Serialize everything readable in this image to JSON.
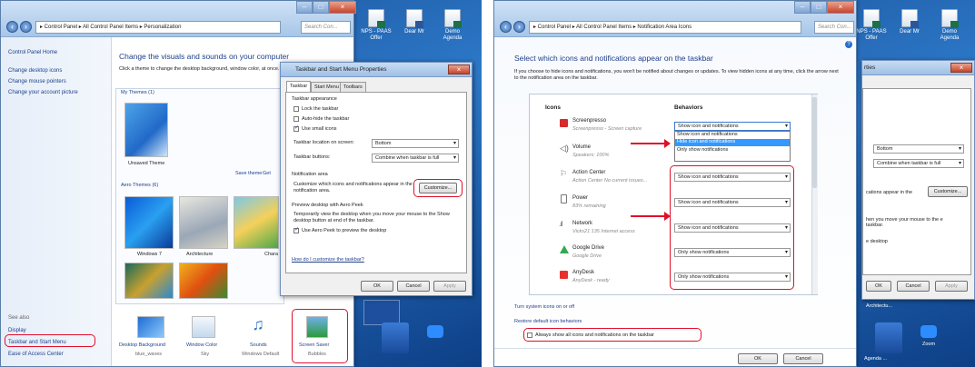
{
  "left": {
    "address": "▸ Control Panel ▸ All Control Panel Items ▸ Personalization",
    "search_placeholder": "Search Con...",
    "desktop_icons": [
      {
        "label": "NPS - PAAS Offer"
      },
      {
        "label": "Dear Mr"
      },
      {
        "label": "Demo Agenda"
      }
    ],
    "sidebar": {
      "home": "Control Panel Home",
      "links": [
        "Change desktop icons",
        "Change mouse pointers",
        "Change your account picture"
      ],
      "see_also": "See also",
      "see_also_links": [
        "Display",
        "Taskbar and Start Menu",
        "Ease of Access Center"
      ]
    },
    "main": {
      "title": "Change the visuals and sounds on your computer",
      "subtitle": "Click a theme to change the desktop background, window color, at once.",
      "my_themes": "My Themes (1)",
      "unsaved_theme": "Unsaved Theme",
      "save_theme": "Save theme",
      "get_more": "Get",
      "aero_themes": "Aero Themes (6)",
      "themes": [
        "Windows 7",
        "Architecture",
        "Chara"
      ],
      "bottom": [
        {
          "label": "Desktop Background",
          "sub": "blue_waves"
        },
        {
          "label": "Window Color",
          "sub": "Sky"
        },
        {
          "label": "Sounds",
          "sub": "Windows Default"
        },
        {
          "label": "Screen Saver",
          "sub": "Bubbles"
        }
      ]
    },
    "dialog": {
      "title": "Taskbar and Start Menu Properties",
      "tabs": [
        "Taskbar",
        "Start Menu",
        "Toolbars"
      ],
      "appearance": "Taskbar appearance",
      "lock": "Lock the taskbar",
      "autohide": "Auto-hide the taskbar",
      "small_icons": "Use small icons",
      "location_label": "Taskbar location on screen:",
      "location_value": "Bottom",
      "buttons_label": "Taskbar buttons:",
      "buttons_value": "Combine when taskbar is full",
      "notif_area": "Notification area",
      "notif_text": "Customize which icons and notifications appear in the notification area.",
      "customize": "Customize...",
      "peek_title": "Preview desktop with Aero Peek",
      "peek_text": "Temporarily view the desktop when you move your mouse to the Show desktop button at end of the taskbar.",
      "peek_check": "Use Aero Peek to preview the desktop",
      "howdo": "How do I customize the taskbar?",
      "ok": "OK",
      "cancel": "Cancel",
      "apply": "Apply"
    }
  },
  "right": {
    "address": "▸ Control Panel ▸ All Control Panel Items ▸ Notification Area Icons",
    "search_placeholder": "Search Con...",
    "desktop_icons": [
      {
        "label": "NPS - PAAS Offer"
      },
      {
        "label": "Dear Mr"
      },
      {
        "label": "Demo Agenda"
      }
    ],
    "title": "Select which icons and notifications appear on the taskbar",
    "desc": "If you choose to hide icons and notifications, you won't be notified about changes or updates. To view hidden icons at any time, click the arrow next to the notification area on the taskbar.",
    "col_icons": "Icons",
    "col_behaviors": "Behaviors",
    "rows": [
      {
        "name": "Screenpresso",
        "sub": "Screenpresso - Screen capture",
        "value": "Show icon and notifications",
        "color": "#d62b2b"
      },
      {
        "name": "Volume",
        "sub": "Speakers: 100%",
        "value": "",
        "color": "#9aa4ae"
      },
      {
        "name": "Action Center",
        "sub": "Action Center  No current issues...",
        "value": "Show icon and notifications",
        "color": "#c9ccd1"
      },
      {
        "name": "Power",
        "sub": "83% remaining",
        "value": "Show icon and notifications",
        "color": "#c9ccd1"
      },
      {
        "name": "Network",
        "sub": "Vicks21  135 Internet access",
        "value": "Show icon and notifications",
        "color": "#8a96a2"
      },
      {
        "name": "Google Drive",
        "sub": "Google Drive",
        "value": "Only show notifications",
        "color": "#34a853"
      },
      {
        "name": "AnyDesk",
        "sub": "AnyDesk - ready",
        "value": "Only show notifications",
        "color": "#e8312f"
      }
    ],
    "dropdown_options": [
      "Show icon and notifications",
      "Hide icon and notifications",
      "Only show notifications"
    ],
    "turn_system": "Turn system icons on or off",
    "restore": "Restore default icon behaviors",
    "always_show": "Always show all icons and notifications on the taskbar",
    "ok": "OK",
    "cancel": "Cancel",
    "bg_dialog": {
      "tab_fragment": "rties",
      "location_value": "Bottom",
      "buttons_value": "Combine when taskbar is full",
      "notif_fragment": "cations appear in the",
      "customize": "Customize...",
      "peek_fragment": "hen you move your mouse to the e taskbar.",
      "desktop_fragment": "e desktop",
      "ok": "OK",
      "cancel": "Cancel",
      "apply": "Apply"
    },
    "taskbar_labels": [
      "Architectu...",
      "Agenda ...",
      "Zoom"
    ]
  }
}
